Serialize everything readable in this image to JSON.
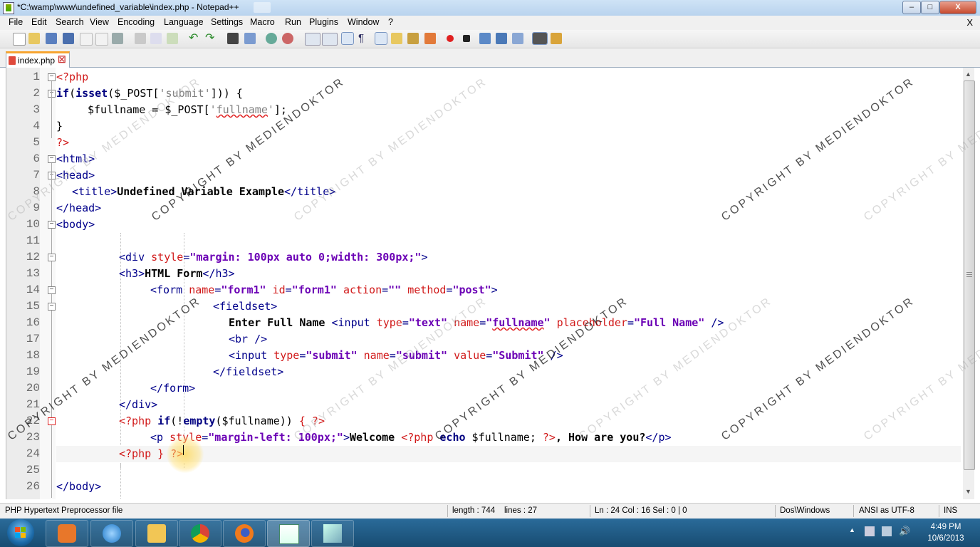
{
  "window": {
    "title": "*C:\\wamp\\www\\undefined_variable\\index.php - Notepad++",
    "controls": {
      "minimize": "–",
      "maximize": "□",
      "close": "X"
    }
  },
  "menu": {
    "items": [
      "File",
      "Edit",
      "Search",
      "View",
      "Encoding",
      "Language",
      "Settings",
      "Macro",
      "Run",
      "Plugins",
      "Window",
      "?"
    ],
    "close_x": "X"
  },
  "toolbar": {
    "icons": [
      "new-file-icon",
      "open-file-icon",
      "save-icon",
      "save-all-icon",
      "close-icon",
      "close-all-icon",
      "print-icon",
      "cut-icon",
      "copy-icon",
      "paste-icon",
      "undo-icon",
      "redo-icon",
      "find-icon",
      "replace-icon",
      "zoom-in-icon",
      "zoom-out-icon",
      "sync-v-icon",
      "sync-h-icon",
      "word-wrap-icon",
      "show-all-chars-icon",
      "indent-guide-icon",
      "user-lang-icon",
      "doc-map-icon",
      "function-list-icon",
      "record-macro-icon",
      "stop-macro-icon",
      "play-macro-icon",
      "run-macro-multiple-icon",
      "save-macro-icon",
      "ds-plugin-icon",
      "extra-plugin-icon"
    ]
  },
  "tab": {
    "label": "index.php",
    "close": "☒"
  },
  "editor": {
    "line_numbers": [
      "1",
      "2",
      "3",
      "4",
      "5",
      "6",
      "7",
      "8",
      "9",
      "10",
      "11",
      "12",
      "13",
      "14",
      "15",
      "16",
      "17",
      "18",
      "19",
      "20",
      "21",
      "22",
      "23",
      "24",
      "25",
      "26"
    ],
    "current_line": 24
  },
  "statusbar": {
    "file_type": "PHP Hypertext Preprocessor file",
    "length": "length : 744",
    "lines": "lines : 27",
    "position": "Ln : 24    Col : 16    Sel : 0 | 0",
    "eol": "Dos\\Windows",
    "encoding": "ANSI as UTF-8",
    "mode": "INS"
  },
  "taskbar": {
    "apps": [
      "media-player-icon",
      "internet-explorer-icon",
      "file-explorer-icon",
      "chrome-icon",
      "firefox-icon",
      "notepad-plus-plus-icon",
      "extra-app-icon"
    ],
    "time": "4:49 PM",
    "date": "10/6/2013"
  },
  "watermark": {
    "text": "COPYRIGHT BY MEDIENDOKTOR"
  },
  "colors": {
    "php_tag": "#d11a1a",
    "keyword": "#000080",
    "attribute": "#d11a1a",
    "value": "#6b00b5",
    "tab_accent": "#f7a531"
  }
}
